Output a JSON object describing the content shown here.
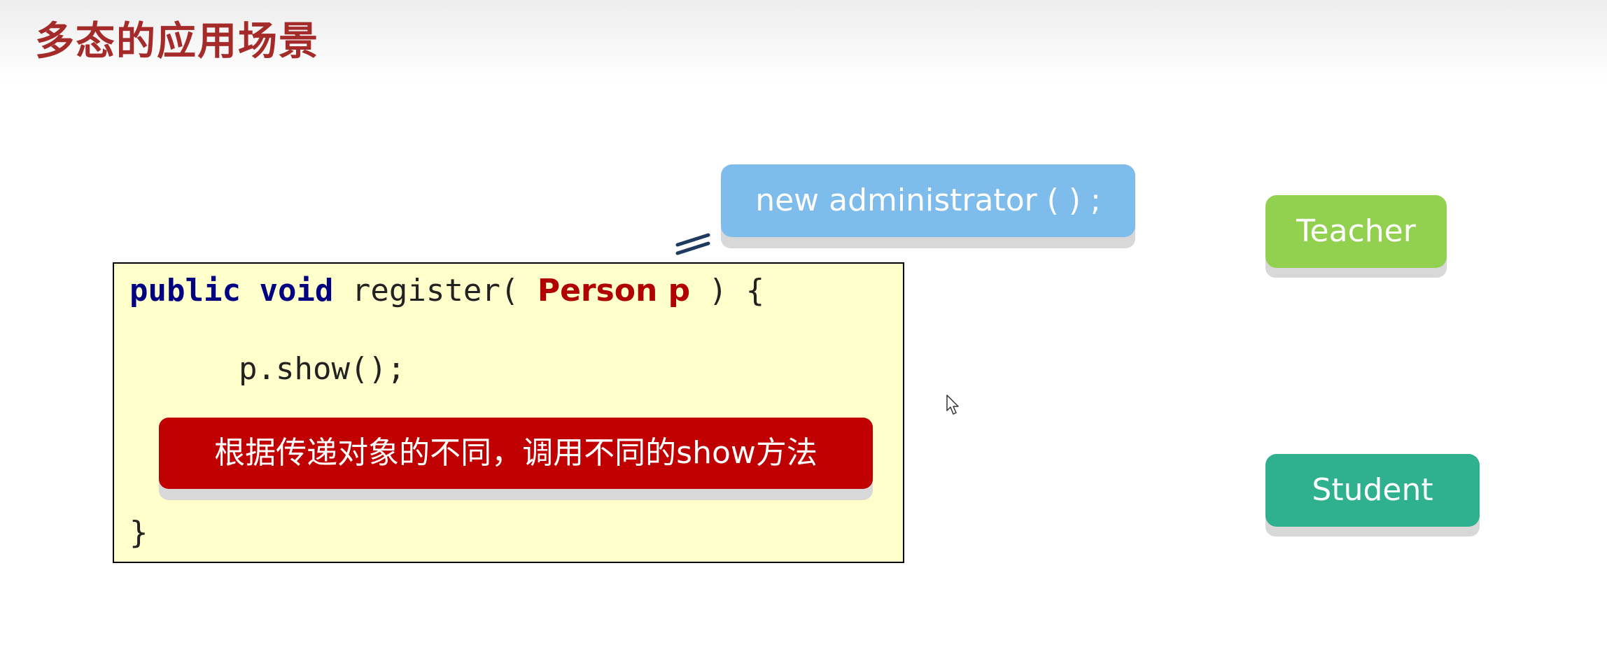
{
  "title": "多态的应用场景",
  "code": {
    "kw_public": "public",
    "kw_void": "void",
    "method_open": " register( ",
    "param": "Person p",
    "method_close": " ) {",
    "body_line": "p.show();",
    "close_brace": "}"
  },
  "callout_note": "根据传递对象的不同，调用不同的show方法",
  "objects": {
    "admin": "new administrator ( ) ;",
    "teacher": "Teacher",
    "student": "Student"
  },
  "colors": {
    "title": "#a52a2a",
    "keyword": "#000080",
    "param": "#b00000",
    "code_bg": "#ffffcc",
    "note_bg": "#c00000",
    "admin_bg": "#7ebcec",
    "teacher_bg": "#92d050",
    "student_bg": "#2fb08f"
  },
  "icons": {
    "equals": "equals-sign-icon",
    "cursor": "mouse-pointer-icon"
  }
}
